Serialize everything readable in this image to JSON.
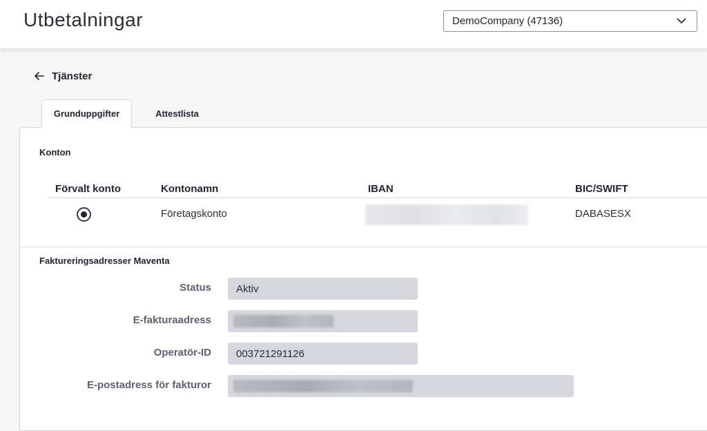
{
  "header": {
    "title": "Utbetalningar",
    "company_select": {
      "value": "DemoCompany (47136)"
    }
  },
  "back": {
    "label": "Tjänster"
  },
  "tabs": [
    {
      "label": "Grunduppgifter",
      "active": true
    },
    {
      "label": "Attestlista",
      "active": false
    }
  ],
  "accounts": {
    "section_title": "Konton",
    "columns": [
      "Förvalt konto",
      "Kontonamn",
      "IBAN",
      "BIC/SWIFT"
    ],
    "rows": [
      {
        "default": true,
        "name": "Företagskonto",
        "iban_hidden": true,
        "bic": "DABASESX"
      }
    ]
  },
  "billing": {
    "section_title": "Faktureringsadresser Maventa",
    "fields": [
      {
        "label": "Status",
        "value": "Aktiv"
      },
      {
        "label": "E-fakturaadress",
        "value": ""
      },
      {
        "label": "Operatör-ID",
        "value": "003721291126"
      },
      {
        "label": "E-postadress för fakturor",
        "value": ""
      }
    ]
  },
  "colors": {
    "background": "#f6f6f7",
    "panel": "#ffffff",
    "field_background": "#d5d7dc",
    "label_text": "#5d6070"
  }
}
